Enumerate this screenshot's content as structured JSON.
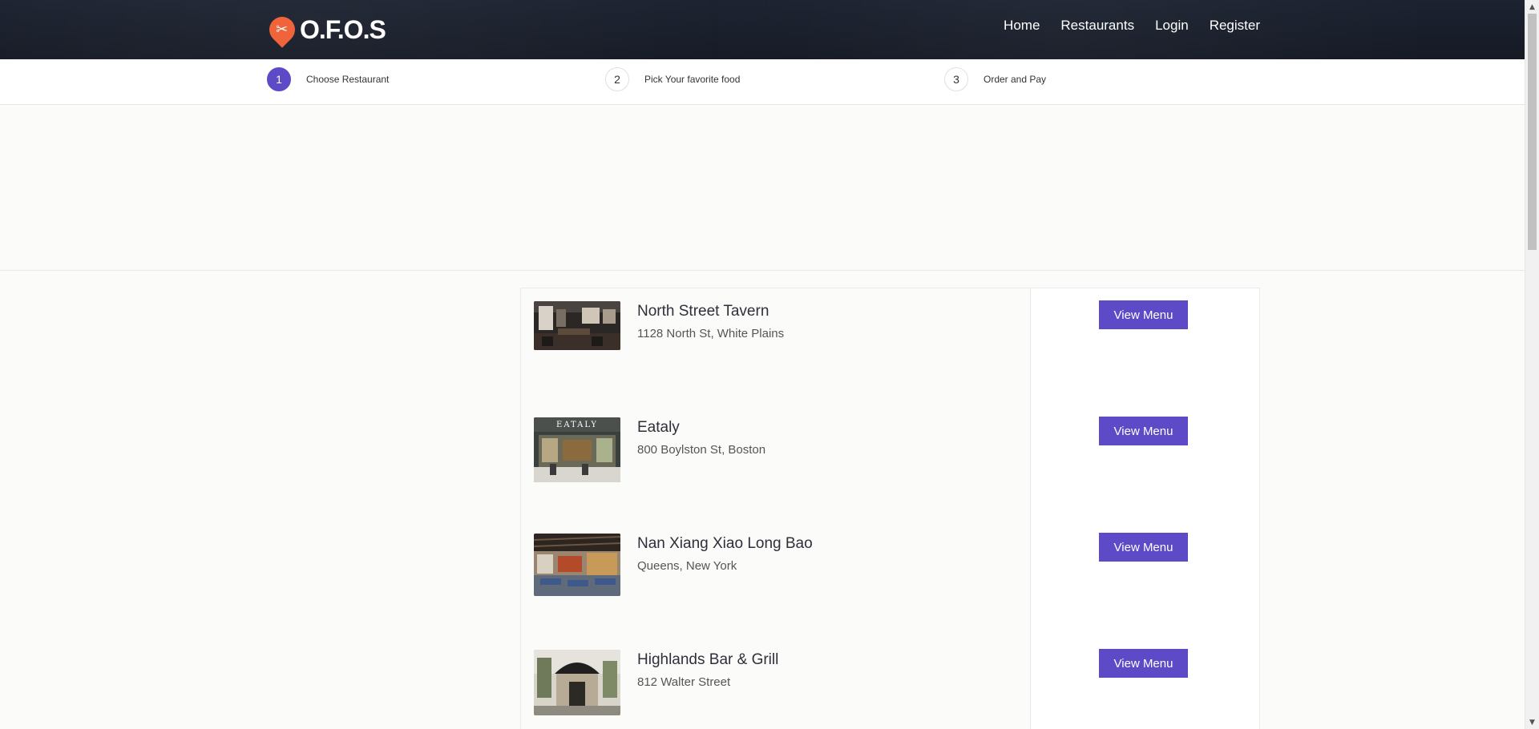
{
  "brand": {
    "logo_text": "O.F.O.S",
    "logo_color": "#f0643c"
  },
  "nav": [
    {
      "label": "Home"
    },
    {
      "label": "Restaurants"
    },
    {
      "label": "Login"
    },
    {
      "label": "Register"
    }
  ],
  "steps": [
    {
      "num": "1",
      "label": "Choose Restaurant",
      "active": true
    },
    {
      "num": "2",
      "label": "Pick Your favorite food",
      "active": false
    },
    {
      "num": "3",
      "label": "Order and Pay",
      "active": false
    }
  ],
  "restaurants": [
    {
      "name": "North Street Tavern",
      "address": "1128 North St, White Plains",
      "button": "View Menu"
    },
    {
      "name": "Eataly",
      "address": "800 Boylston St, Boston",
      "button": "View Menu",
      "sign": "EATALY"
    },
    {
      "name": "Nan Xiang Xiao Long Bao",
      "address": "Queens, New York",
      "button": "View Menu"
    },
    {
      "name": "Highlands Bar & Grill",
      "address": "812 Walter Street",
      "button": "View Menu"
    }
  ],
  "colors": {
    "accent": "#5c4ac7",
    "header_bg": "#1a1f2b"
  }
}
